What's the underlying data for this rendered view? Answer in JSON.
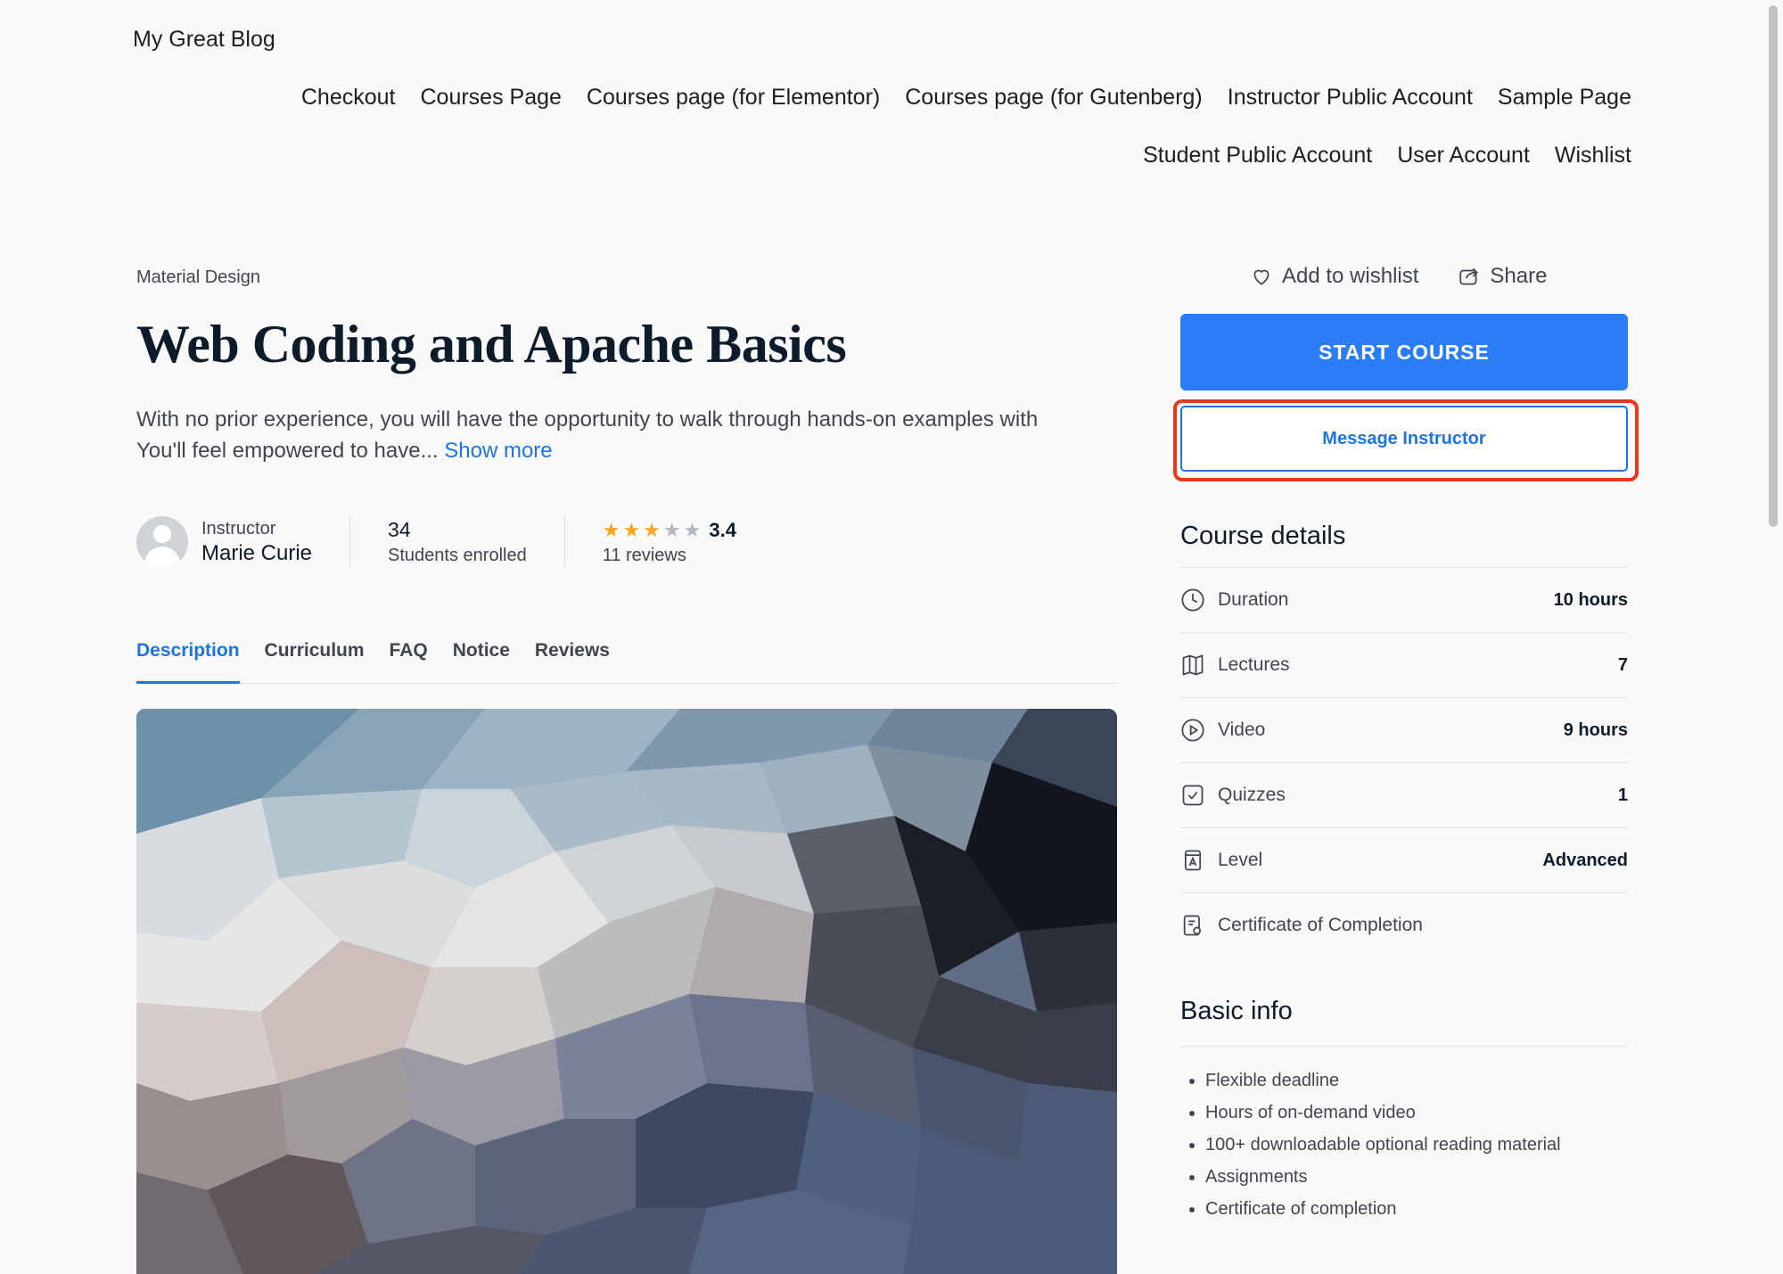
{
  "site": {
    "title": "My Great Blog"
  },
  "nav": {
    "row1": [
      "Checkout",
      "Courses Page",
      "Courses page (for Elementor)",
      "Courses page (for Gutenberg)",
      "Instructor Public Account",
      "Sample Page"
    ],
    "row2": [
      "Student Public Account",
      "User Account",
      "Wishlist"
    ]
  },
  "course": {
    "category": "Material Design",
    "title": "Web Coding and Apache Basics",
    "description_line1": "With no prior experience, you will have the opportunity to walk through hands-on examples with",
    "description_line2": "You'll feel empowered to have...",
    "show_more": "Show more",
    "instructor_label": "Instructor",
    "instructor_name": "Marie Curie",
    "students_count": "34",
    "students_label": "Students enrolled",
    "rating": "3.4",
    "rating_stars_filled": 3,
    "rating_stars_total": 5,
    "reviews": "11 reviews"
  },
  "tabs": [
    "Description",
    "Curriculum",
    "FAQ",
    "Notice",
    "Reviews"
  ],
  "active_tab": "Description",
  "actions": {
    "wishlist": "Add to wishlist",
    "share": "Share"
  },
  "buttons": {
    "start": "START COURSE",
    "message": "Message Instructor"
  },
  "details": {
    "heading": "Course details",
    "rows": [
      {
        "icon": "clock-icon",
        "label": "Duration",
        "value": "10 hours"
      },
      {
        "icon": "book-icon",
        "label": "Lectures",
        "value": "7"
      },
      {
        "icon": "play-circle-icon",
        "label": "Video",
        "value": "9 hours"
      },
      {
        "icon": "checkbox-icon",
        "label": "Quizzes",
        "value": "1"
      },
      {
        "icon": "level-icon",
        "label": "Level",
        "value": "Advanced"
      },
      {
        "icon": "certificate-icon",
        "label": "Certificate of Completion",
        "value": ""
      }
    ]
  },
  "basic_info": {
    "heading": "Basic info",
    "items": [
      "Flexible deadline",
      "Hours of on-demand video",
      "100+ downloadable optional reading material",
      "Assignments",
      "Certificate of completion"
    ]
  },
  "colors": {
    "accent": "#2a7cf7",
    "link": "#1e75e0",
    "highlight": "#e5391f",
    "star": "#f5a623"
  }
}
